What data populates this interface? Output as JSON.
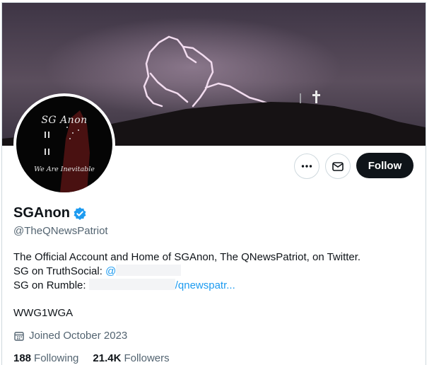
{
  "avatar": {
    "title": "SG Anon",
    "tagline": "We Are Inevitable"
  },
  "actions": {
    "more_icon": "more-horizontal-icon",
    "message_icon": "envelope-icon",
    "follow_label": "Follow"
  },
  "profile": {
    "display_name": "SGAnon",
    "verified_icon": "verified-badge-icon",
    "handle": "@TheQNewsPatriot",
    "bio_line1": "The Official Account and Home of SGAnon, The QNewsPatriot, on Twitter.",
    "bio_line2_prefix": "SG on TruthSocial: ",
    "bio_line2_link": "@",
    "bio_line3_prefix": "SG on Rumble: ",
    "bio_line3_link": "/qnewspatr...",
    "bio_tag": "WWG1WGA",
    "joined": "Joined October 2023",
    "joined_icon": "calendar-icon"
  },
  "stats": {
    "following_count": "188",
    "following_label": "Following",
    "followers_count": "21.4K",
    "followers_label": "Followers"
  },
  "colors": {
    "accent": "#1d9bf0",
    "follow_bg": "#0f1419",
    "muted": "#536471"
  }
}
